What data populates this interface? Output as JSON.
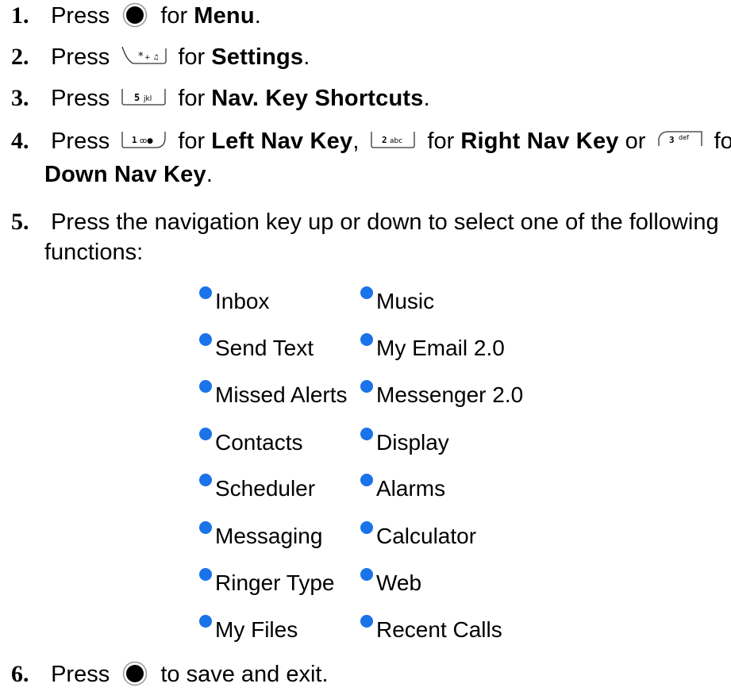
{
  "steps": [
    {
      "num": "1.",
      "pre": "Press",
      "post": "for",
      "bold": "Menu",
      "end": "."
    },
    {
      "num": "2.",
      "pre": "Press",
      "key": "*",
      "post": "for",
      "bold": "Settings",
      "end": "."
    },
    {
      "num": "3.",
      "pre": "Press",
      "key": "5 jkl",
      "post": "for",
      "bold": "Nav. Key Shortcuts",
      "end": "."
    },
    {
      "num": "4.",
      "pre": "Press",
      "key1": "1",
      "post1": "for",
      "bold1": "Left Nav Key",
      "sep1": ",",
      "key2": "2 abc",
      "post2": "for",
      "bold2": "Right Nav Key",
      "sep2": "or",
      "key3": "3 def",
      "post3": "for",
      "bold3": "Down Nav Key",
      "end": "."
    },
    {
      "num": "5.",
      "line1": "Press the navigation key up or down to select one of the following",
      "line2": "functions:"
    },
    {
      "num": "6.",
      "pre": "Press",
      "post": "to save and exit."
    }
  ],
  "functions_left": [
    "Inbox",
    "Send Text",
    "Missed Alerts",
    "Contacts",
    "Scheduler",
    "Messaging",
    "Ringer Type",
    "My Files"
  ],
  "functions_right": [
    "Music",
    "My Email 2.0",
    "Messenger 2.0",
    "Display",
    "Alarms",
    "Calculator",
    "Web",
    "Recent Calls"
  ],
  "colors": {
    "bullet": "#1a73e8"
  },
  "icons": {
    "ok_key": "ok-key-icon",
    "star_key": "star-key-icon",
    "key5": "key-5-icon",
    "key1": "key-1-icon",
    "key2": "key-2-icon",
    "key3": "key-3-icon"
  }
}
